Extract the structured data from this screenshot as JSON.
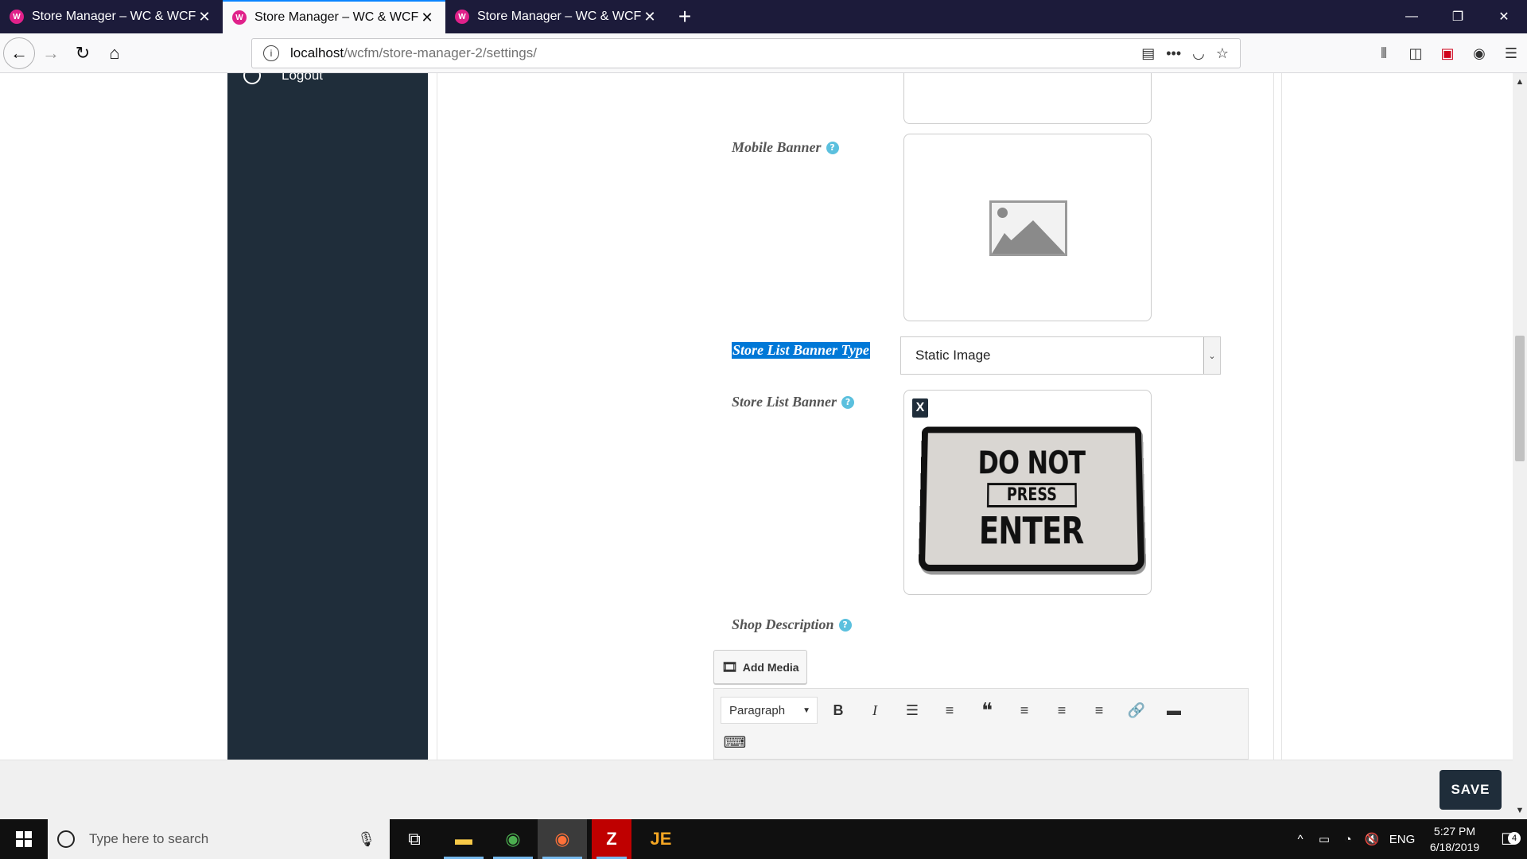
{
  "browser": {
    "tabs": [
      {
        "title": "Store Manager – WC & WCFM",
        "active": false
      },
      {
        "title": "Store Manager – WC & WCFM",
        "active": true
      },
      {
        "title": "Store Manager – WC & WCFM",
        "active": false
      }
    ],
    "url_host": "localhost",
    "url_path": "/wcfm/store-manager-2/settings/"
  },
  "sidebar": {
    "logout_label": "Logout"
  },
  "form": {
    "mobile_banner_label": "Mobile Banner",
    "store_list_banner_type_label": "Store List Banner Type",
    "store_list_banner_type_value": "Static Image",
    "store_list_banner_label": "Store List Banner",
    "remove_label": "X",
    "banner_image": {
      "line1": "DO NOT",
      "line2": "PRESS",
      "line3": "ENTER"
    },
    "shop_description_label": "Shop Description",
    "add_media_label": "Add Media",
    "editor_format_value": "Paragraph",
    "editor_buttons": [
      "bold-icon",
      "italic-icon",
      "bullet-list-icon",
      "numbered-list-icon",
      "blockquote-icon",
      "align-left-icon",
      "align-center-icon",
      "align-right-icon",
      "link-icon",
      "read-more-icon",
      "keyboard-icon"
    ]
  },
  "save_label": "SAVE",
  "taskbar": {
    "search_placeholder": "Type here to search",
    "language": "ENG",
    "time": "5:27 PM",
    "date": "6/18/2019",
    "notification_count": "4"
  },
  "colors": {
    "sidebar_bg": "#1f2d3a",
    "selection_bg": "#0078d7",
    "help_icon": "#5bc0de",
    "tab_active_accent": "#0a84ff"
  }
}
